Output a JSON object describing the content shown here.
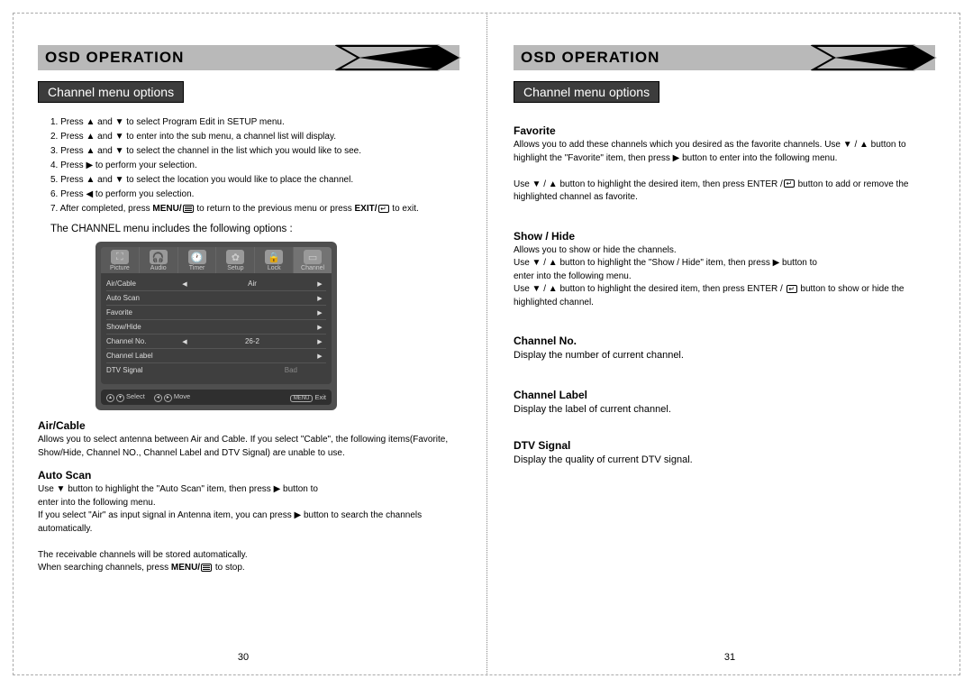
{
  "left": {
    "header_title": "OSD OPERATION",
    "subheader": "Channel menu options",
    "steps": [
      "1. Press ▲ and ▼ to select Program Edit in SETUP menu.",
      "2. Press ▲ and ▼ to enter into the sub menu, a channel list will display.",
      "3. Press ▲ and ▼ to select the  channel in the list which you would like to see.",
      "4. Press ▶ to perform your selection.",
      "5. Press ▲ and ▼ to select the location you would like to place the channel.",
      "6. Press ◀ to perform you selection.",
      "7. After completed, press MENU/ [≡] to return to the previous menu or press EXIT/ [↵] to exit."
    ],
    "intro": "The CHANNEL menu includes the following options :",
    "osd": {
      "tabs": [
        {
          "label": "Picture",
          "icon": "⛶"
        },
        {
          "label": "Audio",
          "icon": "🎧"
        },
        {
          "label": "Timer",
          "icon": "🕐"
        },
        {
          "label": "Setup",
          "icon": "✿"
        },
        {
          "label": "Lock",
          "icon": "🔒"
        },
        {
          "label": "Channel",
          "icon": "▭"
        }
      ],
      "active_tab": 5,
      "rows": [
        {
          "lbl": "Air/Cable",
          "l": "◀",
          "val": "Air",
          "r": "▶"
        },
        {
          "lbl": "Auto Scan",
          "l": "",
          "val": "",
          "r": "▶"
        },
        {
          "lbl": "Favorite",
          "l": "",
          "val": "",
          "r": "▶"
        },
        {
          "lbl": "Show/Hide",
          "l": "",
          "val": "",
          "r": "▶"
        },
        {
          "lbl": "Channel No.",
          "l": "◀",
          "val": "26-2",
          "r": "▶"
        },
        {
          "lbl": "Channel Label",
          "l": "",
          "val": "",
          "r": "▶"
        },
        {
          "lbl": "DTV Signal",
          "l": "",
          "val": "Bad",
          "r": ""
        }
      ],
      "footer_select": "Select",
      "footer_move": "Move",
      "footer_exit": "Exit",
      "footer_menu": "MENU"
    },
    "sections": [
      {
        "h": "Air/Cable",
        "p": "Allows you to select antenna between Air and Cable. If you select \"Cable\", the following items(Favorite, Show/Hide, Channel NO., Channel Label and DTV Signal) are unable to use."
      },
      {
        "h": "Auto Scan",
        "p": "Use ▼ button to highlight the \"Auto Scan\" item, then press ▶ button to enter into the following menu.\nIf you select \"Air\" as input signal in Antenna item, you can press ▶ button to search the channels automatically.\nThe receivable channels will be stored automatically.\nWhen searching channels, press MENU/ [≡] to stop."
      }
    ],
    "page_num": "30"
  },
  "right": {
    "header_title": "OSD OPERATION",
    "subheader": "Channel menu options",
    "sections": [
      {
        "h": "Favorite",
        "p": "Allows you to add these channels which you desired as the favorite channels. Use ▼ / ▲ button to highlight the \"Favorite\" item, then press ▶ button to enter into the following menu.\n\nUse ▼ / ▲ button to highlight the desired item, then press ENTER / [↵] button to add or remove the highlighted channel as favorite."
      },
      {
        "h": "Show / Hide",
        "p": "Allows you to show or hide the channels.\nUse ▼ / ▲ button to highlight the \"Show / Hide\" item, then press ▶ button to enter into the following menu.\nUse ▼ / ▲ button to highlight the desired item, then press ENTER / [↵] button to show or hide the highlighted channel."
      },
      {
        "h": "Channel No.",
        "p": " Display the number of current channel."
      },
      {
        "h": "Channel Label",
        "p": "Display the label of current channel."
      },
      {
        "h": "DTV Signal",
        "p": "Display the quality of current DTV signal."
      }
    ],
    "page_num": "31"
  }
}
